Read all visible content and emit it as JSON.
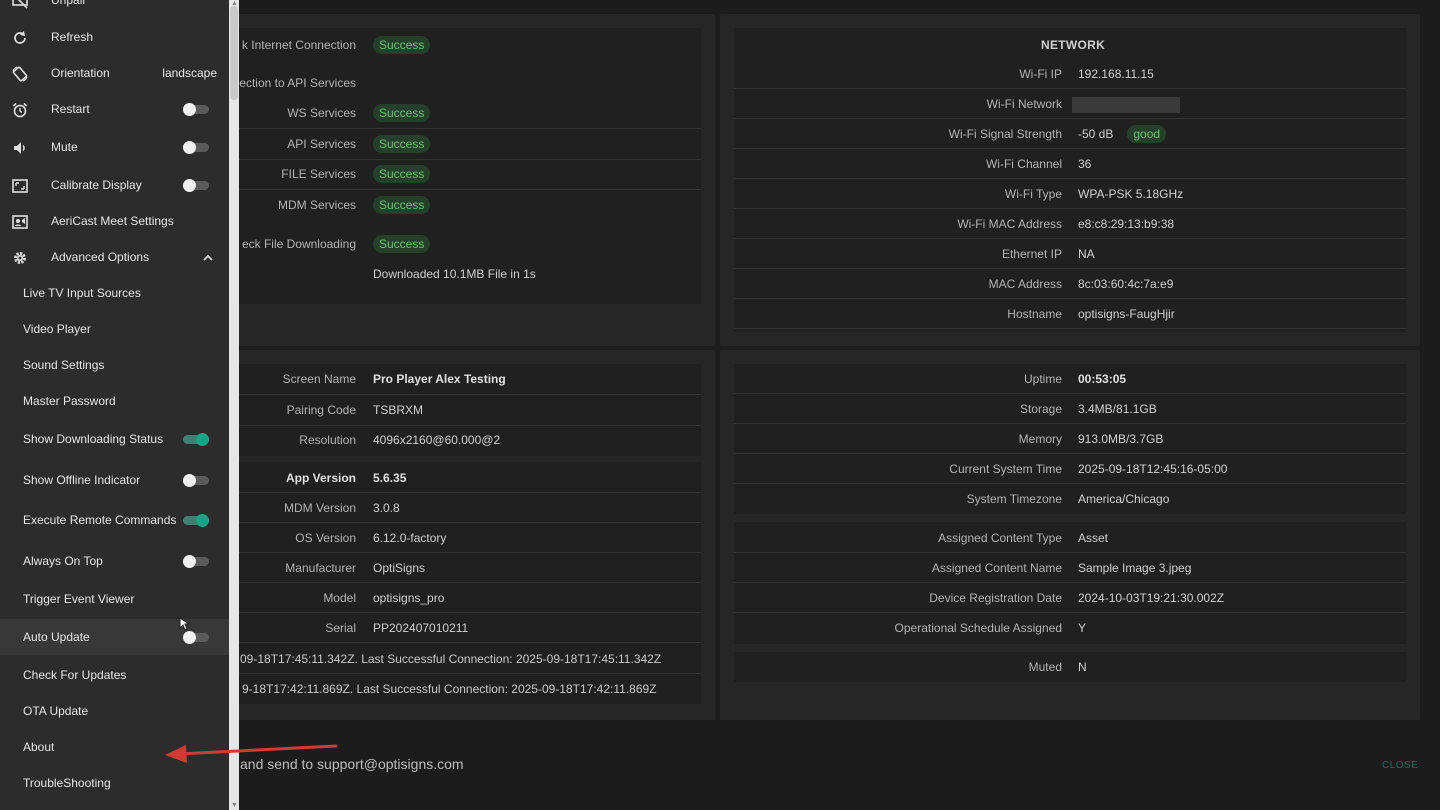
{
  "connection": {
    "internet": {
      "label": "k Internet Connection",
      "status": "Success"
    },
    "api_heading": "ection to API Services",
    "services": [
      {
        "label": "WS Services",
        "status": "Success"
      },
      {
        "label": "API Services",
        "status": "Success"
      },
      {
        "label": "FILE Services",
        "status": "Success"
      },
      {
        "label": "MDM Services",
        "status": "Success"
      }
    ],
    "file_download": {
      "label": "eck File Downloading",
      "status": "Success",
      "detail": "Downloaded 10.1MB File in 1s"
    }
  },
  "network": {
    "title": "NETWORK",
    "rows": [
      {
        "label": "Wi-Fi IP",
        "value": "192.168.11.15"
      },
      {
        "label": "Wi-Fi Network",
        "value": ""
      },
      {
        "label": "Wi-Fi Signal Strength",
        "value": "-50 dB",
        "badge": "good"
      },
      {
        "label": "Wi-Fi Channel",
        "value": "36"
      },
      {
        "label": "Wi-Fi Type",
        "value": "WPA-PSK 5.18GHz"
      },
      {
        "label": "Wi-Fi MAC Address",
        "value": "e8:c8:29:13:b9:38"
      },
      {
        "label": "Ethernet IP",
        "value": "NA"
      },
      {
        "label": "MAC Address",
        "value": "8c:03:60:4c:7a:e9"
      },
      {
        "label": "Hostname",
        "value": "optisigns-FaugHjir"
      }
    ]
  },
  "device": {
    "group1": [
      {
        "label": "Screen Name",
        "value": "Pro Player Alex Testing"
      },
      {
        "label": "Pairing Code",
        "value": "TSBRXM"
      },
      {
        "label": "Resolution",
        "value": "4096x2160@60.000@2"
      }
    ],
    "group2": [
      {
        "label": "App Version",
        "value": "5.6.35"
      },
      {
        "label": "MDM Version",
        "value": "3.0.8"
      },
      {
        "label": "OS Version",
        "value": "6.12.0-factory"
      },
      {
        "label": "Manufacturer",
        "value": "OptiSigns"
      },
      {
        "label": "Model",
        "value": "optisigns_pro"
      },
      {
        "label": "Serial",
        "value": "PP202407010211"
      }
    ],
    "conn1": "09-18T17:45:11.342Z. Last Successful Connection: 2025-09-18T17:45:11.342Z",
    "conn2": "9-18T17:42:11.869Z. Last Successful Connection: 2025-09-18T17:42:11.869Z"
  },
  "system": {
    "group1": [
      {
        "label": "Uptime",
        "value": "00:53:05"
      },
      {
        "label": "Storage",
        "value": "3.4MB/81.1GB"
      },
      {
        "label": "Memory",
        "value": "913.0MB/3.7GB"
      },
      {
        "label": "Current System Time",
        "value": "2025-09-18T12:45:16-05:00"
      },
      {
        "label": "System Timezone",
        "value": "America/Chicago"
      }
    ],
    "group2": [
      {
        "label": "Assigned Content Type",
        "value": "Asset"
      },
      {
        "label": "Assigned Content Name",
        "value": "Sample Image 3.jpeg"
      },
      {
        "label": "Device Registration Date",
        "value": "2024-10-03T19:21:30.002Z"
      },
      {
        "label": "Operational Schedule Assigned",
        "value": "Y"
      }
    ],
    "group3": [
      {
        "label": "Muted",
        "value": "N"
      }
    ]
  },
  "footer": {
    "text": "and send to support@optisigns.com",
    "close": "CLOSE"
  },
  "menu": {
    "items": [
      {
        "label": "Unpair",
        "icon": "unpair-icon"
      },
      {
        "label": "Refresh",
        "icon": "refresh-icon"
      },
      {
        "label": "Orientation",
        "icon": "orientation-icon",
        "value": "landscape"
      },
      {
        "label": "Restart",
        "icon": "alarm-icon",
        "toggle": false
      },
      {
        "label": "Mute",
        "icon": "speaker-icon",
        "toggle": false
      },
      {
        "label": "Calibrate Display",
        "icon": "calibrate-icon",
        "toggle": false
      },
      {
        "label": "AeriCast Meet Settings",
        "icon": "meet-icon"
      },
      {
        "label": "Advanced Options",
        "icon": "gear-icon",
        "expanded": true
      },
      {
        "label": "Live TV Input Sources"
      },
      {
        "label": "Video Player"
      },
      {
        "label": "Sound Settings"
      },
      {
        "label": "Master Password"
      },
      {
        "label": "Show Downloading Status",
        "toggle": true
      },
      {
        "label": "Show Offline Indicator",
        "toggle": false
      },
      {
        "label": "Execute Remote Commands",
        "toggle": true
      },
      {
        "label": "Always On Top",
        "toggle": false
      },
      {
        "label": "Trigger Event Viewer"
      },
      {
        "label": "Auto Update",
        "toggle": false
      },
      {
        "label": "Check For Updates"
      },
      {
        "label": "OTA Update"
      },
      {
        "label": "About"
      },
      {
        "label": "TroubleShooting"
      }
    ]
  }
}
